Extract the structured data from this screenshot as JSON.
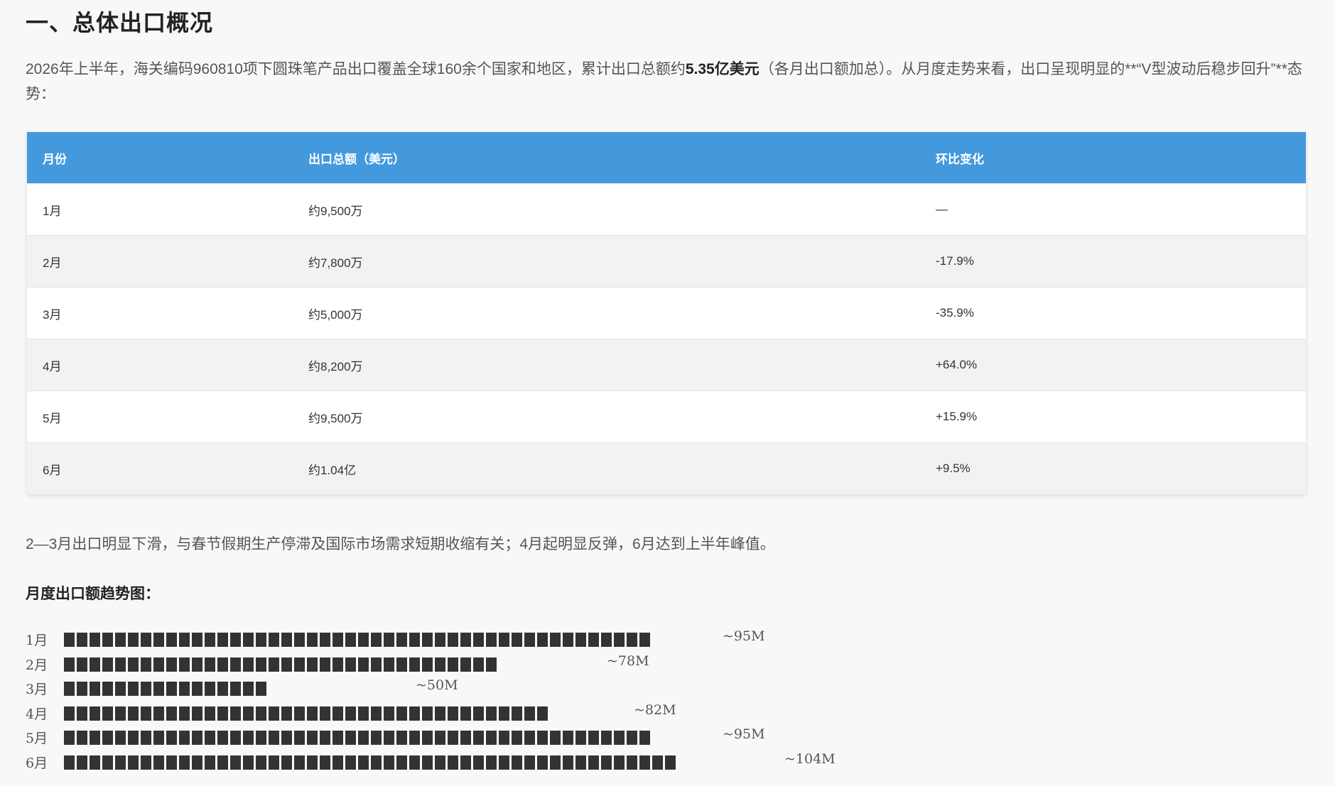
{
  "section": {
    "title": "一、总体出口概况"
  },
  "intro": {
    "text_before": "2026年上半年，海关编码960810项下圆珠笔产品出口覆盖全球160余个国家和地区，累计出口总额约",
    "emphasis": "5.35亿美元",
    "text_after": "（各月出口额加总）。从月度走势来看，出口呈现明显的**“V型波动后稳步回升”**态势："
  },
  "table": {
    "headers": [
      "月份",
      "出口总额（美元）",
      "环比变化"
    ],
    "rows": [
      [
        "1月",
        "约9,500万",
        "—"
      ],
      [
        "2月",
        "约7,800万",
        "-17.9%"
      ],
      [
        "3月",
        "约5,000万",
        "-35.9%"
      ],
      [
        "4月",
        "约8,200万",
        "+64.0%"
      ],
      [
        "5月",
        "约9,500万",
        "+15.9%"
      ],
      [
        "6月",
        "约1.04亿",
        "+9.5%"
      ]
    ]
  },
  "note": "2—3月出口明显下滑，与春节假期生产停滞及国际市场需求短期收缩有关；4月起明显反弹，6月达到上半年峰值。",
  "chart_title": "月度出口额趋势图：",
  "chart_data": {
    "type": "bar",
    "orientation": "horizontal",
    "title": "",
    "categories": [
      "1月",
      "2月",
      "3月",
      "4月",
      "5月",
      "6月"
    ],
    "values": [
      95,
      78,
      50,
      82,
      95,
      104
    ],
    "value_labels": [
      "~95M",
      "~78M",
      "~50M",
      "~82M",
      "~95M",
      "~104M"
    ],
    "block_counts": [
      46,
      34,
      16,
      38,
      46,
      48
    ],
    "xlabel": "",
    "ylabel": "",
    "grid": false,
    "legend": "none",
    "bar_color": "#333333"
  }
}
